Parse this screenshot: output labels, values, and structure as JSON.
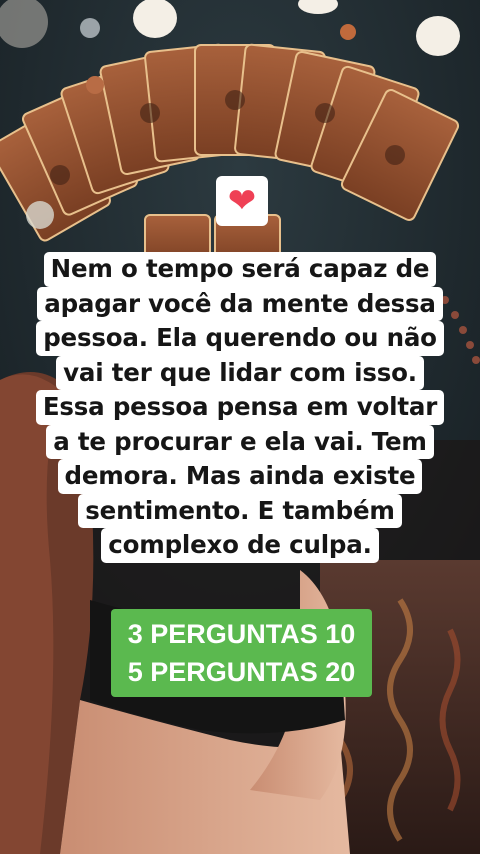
{
  "caption": {
    "lines": [
      "Nem o tempo será capaz de",
      "apagar você da mente dessa",
      "pessoa. Ela querendo ou não",
      "vai ter que lidar com isso.",
      "Essa pessoa pensa em voltar",
      "a te procurar e ela vai. Tem",
      "demora. Mas ainda existe",
      "sentimento. E também",
      "complexo de culpa."
    ]
  },
  "sticker": {
    "icon": "heart-icon",
    "glyph": "❤",
    "color": "#ef4055"
  },
  "prices": {
    "line1": "3 PERGUNTAS 10",
    "line2": "5 PERGUNTAS 20",
    "background": "#5bb94f"
  }
}
